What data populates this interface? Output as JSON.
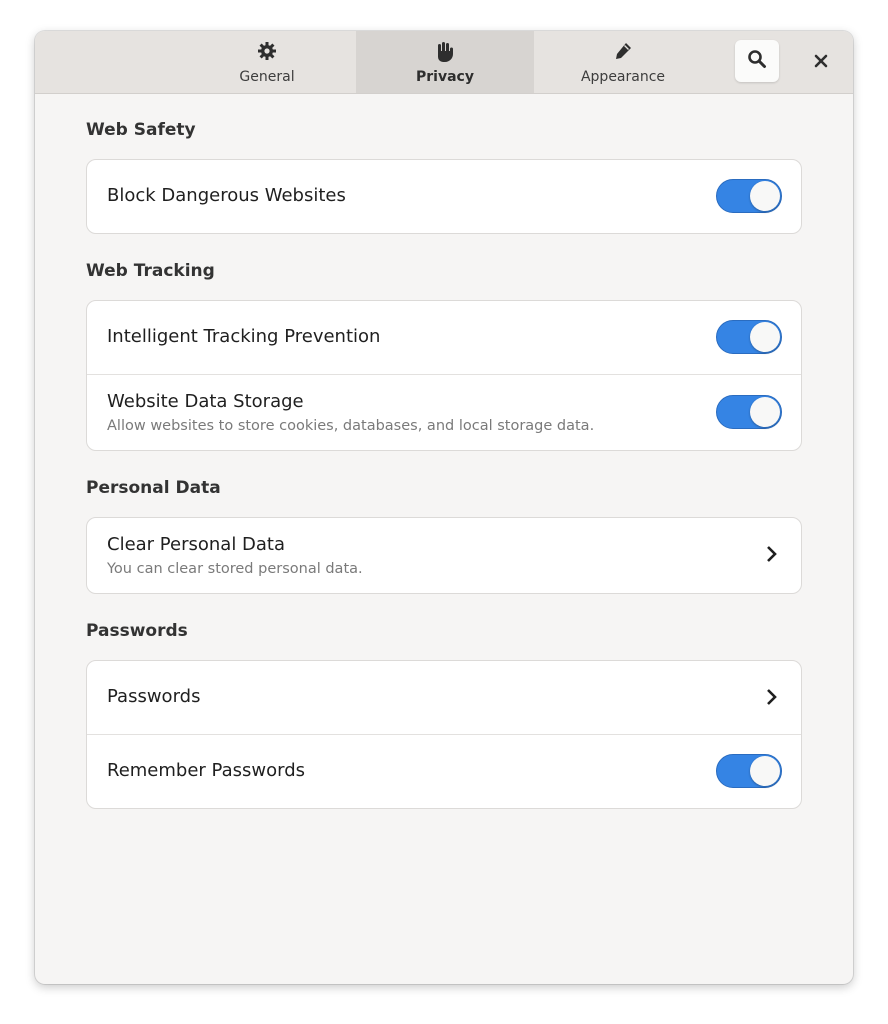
{
  "header": {
    "tabs": [
      {
        "label": "General",
        "icon": "gear-icon",
        "active": false
      },
      {
        "label": "Privacy",
        "icon": "hand-icon",
        "active": true
      },
      {
        "label": "Appearance",
        "icon": "pencil-icon",
        "active": false
      }
    ],
    "search_icon": "search-icon",
    "close_icon": "close-icon"
  },
  "sections": [
    {
      "title": "Web Safety",
      "rows": [
        {
          "title": "Block Dangerous Websites",
          "control": "switch",
          "on": true
        }
      ]
    },
    {
      "title": "Web Tracking",
      "rows": [
        {
          "title": "Intelligent Tracking Prevention",
          "control": "switch",
          "on": true
        },
        {
          "title": "Website Data Storage",
          "subtitle": "Allow websites to store cookies, databases, and local storage data.",
          "control": "switch",
          "on": true
        }
      ]
    },
    {
      "title": "Personal Data",
      "rows": [
        {
          "title": "Clear Personal Data",
          "subtitle": "You can clear stored personal data.",
          "control": "chevron"
        }
      ]
    },
    {
      "title": "Passwords",
      "rows": [
        {
          "title": "Passwords",
          "control": "chevron"
        },
        {
          "title": "Remember Passwords",
          "control": "switch",
          "on": true
        }
      ]
    }
  ],
  "colors": {
    "accent": "#3584e4",
    "window_bg": "#f6f5f4",
    "header_bg": "#e6e3e0"
  }
}
